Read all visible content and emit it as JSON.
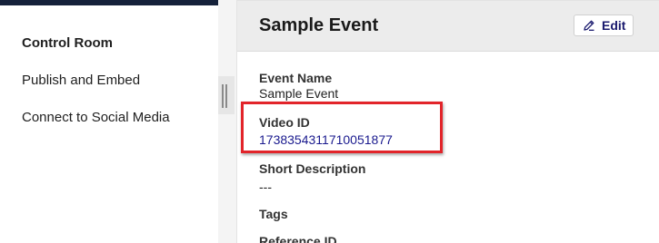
{
  "sidebar": {
    "items": [
      {
        "label": "Control Room",
        "active": true
      },
      {
        "label": "Publish and Embed",
        "active": false
      },
      {
        "label": "Connect to Social Media",
        "active": false
      }
    ]
  },
  "panel": {
    "title": "Sample Event",
    "edit_label": "Edit",
    "edit_icon": "pencil-icon",
    "fields": [
      {
        "label": "Event Name",
        "value": "Sample Event"
      },
      {
        "label": "Video ID",
        "value": "1738354311710051877"
      },
      {
        "label": "Short Description",
        "value": "---"
      },
      {
        "label": "Tags",
        "value": ""
      },
      {
        "label": "Reference ID",
        "value": ""
      }
    ]
  },
  "colors": {
    "accent_link": "#1a1a8e",
    "highlight": "#e2242a",
    "top_bar": "#15213a"
  }
}
